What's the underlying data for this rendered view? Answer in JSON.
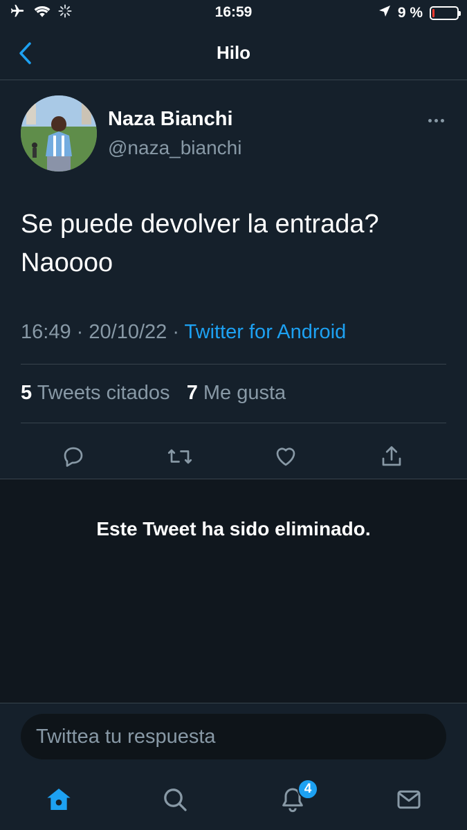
{
  "status_bar": {
    "time": "16:59",
    "battery_percent": "9 %",
    "battery_level": 0.09,
    "icons": [
      "airplane-icon",
      "wifi-icon",
      "activity-spinner-icon",
      "location-arrow-icon",
      "battery-icon"
    ]
  },
  "header": {
    "title": "Hilo",
    "back_icon": "chevron-left-icon"
  },
  "tweet": {
    "author_name": "Naza Bianchi",
    "author_handle": "@naza_bianchi",
    "text": "Se puede devolver la entrada? Naoooo",
    "time": "16:49",
    "separator": "·",
    "date": "20/10/22",
    "source": "Twitter for Android",
    "stats": {
      "quoted_count": "5",
      "quoted_label": "Tweets citados",
      "likes_count": "7",
      "likes_label": "Me gusta"
    },
    "actions": [
      "reply-icon",
      "retweet-icon",
      "like-icon",
      "share-icon"
    ]
  },
  "deleted_notice": "Este Tweet ha sido eliminado.",
  "reply": {
    "placeholder": "Twittea tu respuesta"
  },
  "tab_bar": {
    "tabs": [
      "home-icon",
      "search-icon",
      "notifications-icon",
      "messages-icon"
    ],
    "notifications_badge": "4"
  },
  "colors": {
    "background": "#15202b",
    "accent": "#1da1f2",
    "secondary_text": "#8899a6",
    "divider": "#38444d",
    "battery_low": "#ff3b30"
  }
}
